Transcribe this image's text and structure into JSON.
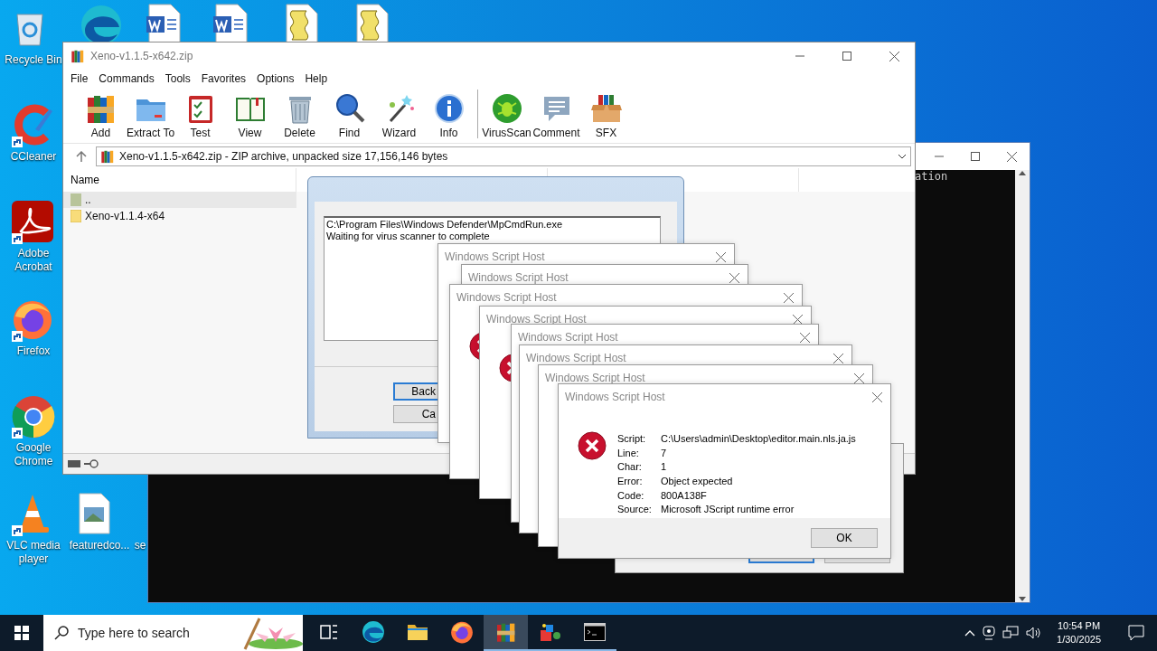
{
  "desktop_icons": [
    {
      "kind": "recycle",
      "label": "Recycle Bin",
      "shortcut": false
    },
    {
      "kind": "ccleaner",
      "label": "CCleaner",
      "shortcut": true
    },
    {
      "kind": "acrobat",
      "label": "Adobe Acrobat",
      "shortcut": true
    },
    {
      "kind": "firefox",
      "label": "Firefox",
      "shortcut": true
    },
    {
      "kind": "chrome",
      "label": "Google Chrome",
      "shortcut": true
    },
    {
      "kind": "vlc",
      "label": "VLC media player",
      "shortcut": true
    },
    {
      "kind": "image",
      "label": "featuredco...",
      "shortcut": false
    },
    {
      "kind": "none",
      "label": "se",
      "shortcut": false
    },
    {
      "kind": "edge"
    },
    {
      "kind": "word"
    },
    {
      "kind": "word"
    },
    {
      "kind": "script"
    },
    {
      "kind": "script"
    }
  ],
  "console": {
    "text": "ation"
  },
  "winrar": {
    "title": "Xeno-v1.1.5-x642.zip",
    "menu": [
      "File",
      "Commands",
      "Tools",
      "Favorites",
      "Options",
      "Help"
    ],
    "toolbar": [
      {
        "kind": "add",
        "label": "Add",
        "separated": false
      },
      {
        "kind": "extract",
        "label": "Extract To",
        "separated": false
      },
      {
        "kind": "test",
        "label": "Test",
        "separated": false
      },
      {
        "kind": "view",
        "label": "View",
        "separated": false
      },
      {
        "kind": "delete",
        "label": "Delete",
        "separated": false
      },
      {
        "kind": "find",
        "label": "Find",
        "separated": false
      },
      {
        "kind": "wizard",
        "label": "Wizard",
        "separated": false
      },
      {
        "kind": "info",
        "label": "Info",
        "separated": false
      },
      {
        "kind": "virusscan",
        "label": "VirusScan",
        "separated": true
      },
      {
        "kind": "comment",
        "label": "Comment",
        "separated": false
      },
      {
        "kind": "sfx",
        "label": "SFX",
        "separated": false
      }
    ],
    "address": "Xeno-v1.1.5-x642.zip - ZIP archive, unpacked size 17,156,146 bytes",
    "columns": [
      "Name"
    ],
    "rows": [
      {
        "name": "..",
        "kind": "up",
        "selected": true
      },
      {
        "name": "Xeno-v1.1.4-x64",
        "kind": "folder",
        "selected": false
      }
    ]
  },
  "progress_dialog": {
    "log": [
      "C:\\Program Files\\Windows Defender\\MpCmdRun.exe",
      "Waiting for virus scanner to complete"
    ],
    "buttons": [
      {
        "label": "Back",
        "focused": true
      },
      {
        "label": "Ca",
        "focused": false
      }
    ]
  },
  "script_host_dialogs": [
    {
      "title": "Windows Script Host"
    },
    {
      "title": "Windows Script Host"
    },
    {
      "title": "Windows Script Host"
    },
    {
      "title": "Windows Script Host"
    },
    {
      "title": "Windows Script Host"
    },
    {
      "title": "Windows Script Host"
    },
    {
      "title": "Windows Script Host"
    },
    {
      "title": "Windows Script Host",
      "fields": [
        {
          "label": "Script:",
          "value": "C:\\Users\\admin\\Desktop\\editor.main.nls.ja.js"
        },
        {
          "label": "Line:",
          "value": "7"
        },
        {
          "label": "Char:",
          "value": "1"
        },
        {
          "label": "Error:",
          "value": "Object expected"
        },
        {
          "label": "Code:",
          "value": "800A138F"
        },
        {
          "label": "Source:",
          "value": "Microsoft JScript runtime error"
        }
      ],
      "button": "OK"
    }
  ],
  "taskbar": {
    "search_placeholder": "Type here to search",
    "apps": [
      {
        "kind": "taskview",
        "running": false,
        "selected": false
      },
      {
        "kind": "edge",
        "running": false,
        "selected": false
      },
      {
        "kind": "explorer",
        "running": false,
        "selected": false
      },
      {
        "kind": "firefox",
        "running": false,
        "selected": false
      },
      {
        "kind": "winrar",
        "running": true,
        "selected": true
      },
      {
        "kind": "app",
        "running": true,
        "selected": false
      },
      {
        "kind": "cmd",
        "running": true,
        "selected": false
      }
    ],
    "time": "10:54 PM",
    "date": "1/30/2025"
  }
}
